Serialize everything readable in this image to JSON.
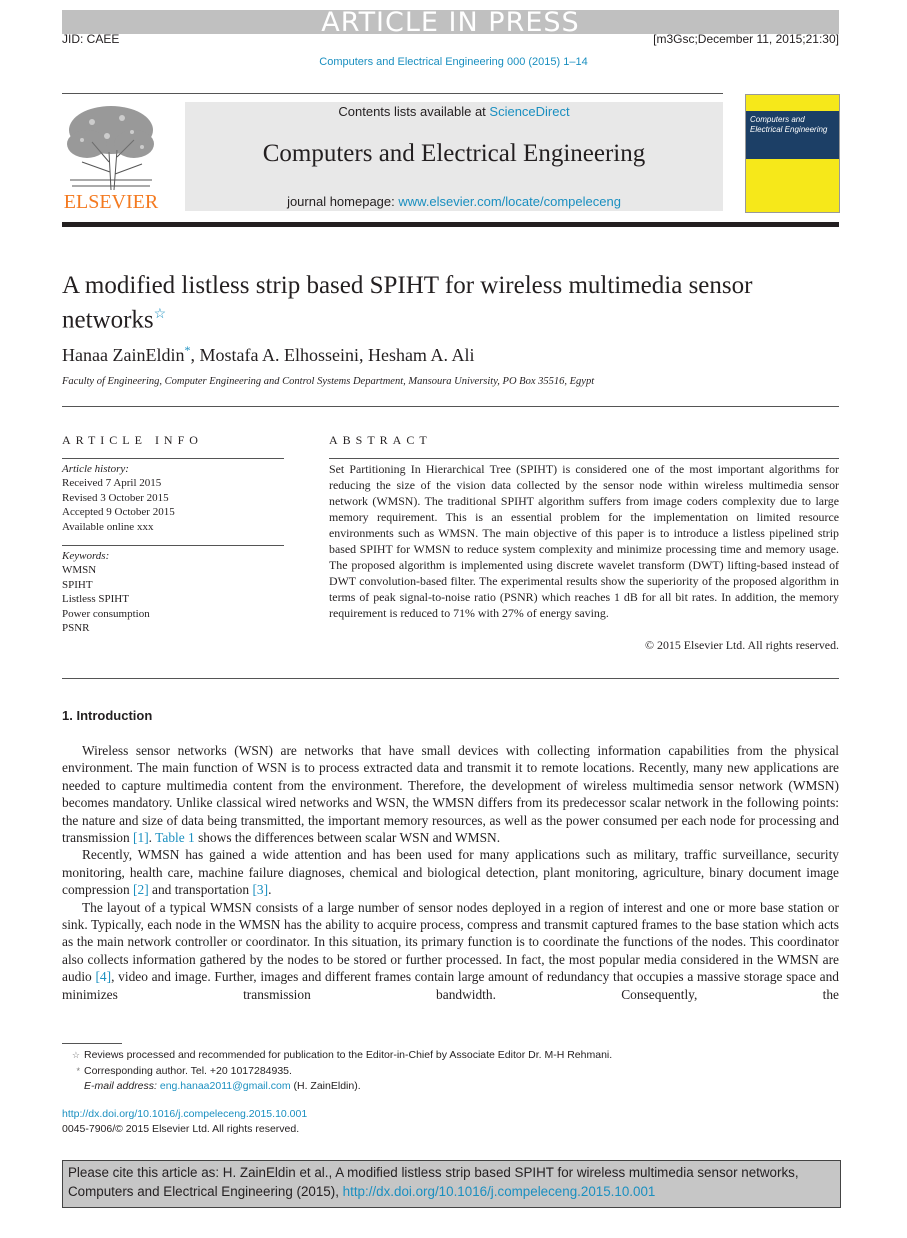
{
  "banner": {
    "status": "ARTICLE IN PRESS",
    "jid": "JID: CAEE",
    "stamp": "[m3Gsc;December 11, 2015;21:30]",
    "journal_ref": "Computers and Electrical Engineering 000 (2015) 1–14"
  },
  "masthead": {
    "publisher": "ELSEVIER",
    "contents_prefix": "Contents lists available at ",
    "contents_link": "ScienceDirect",
    "journal_title": "Computers and Electrical Engineering",
    "homepage_prefix": "journal homepage: ",
    "homepage_link": "www.elsevier.com/locate/compeleceng",
    "cover_title_line1": "Computers and",
    "cover_title_line2": "Electrical Engineering",
    "colors": {
      "publisher_orange": "#f47a20",
      "link_blue": "#1a8fc0",
      "cover_yellow": "#f6e81a",
      "cover_navy": "#1c3f66"
    }
  },
  "article": {
    "title": "A modified listless strip based SPIHT for wireless multimedia sensor networks",
    "title_mark": "☆",
    "authors": [
      {
        "name": "Hanaa ZainEldin",
        "mark": "*",
        "sep": ", "
      },
      {
        "name": "Mostafa A. Elhosseini",
        "mark": "",
        "sep": ", "
      },
      {
        "name": "Hesham A. Ali",
        "mark": "",
        "sep": ""
      }
    ],
    "affiliation": "Faculty of Engineering, Computer Engineering and Control Systems Department, Mansoura University, PO Box 35516, Egypt"
  },
  "article_info": {
    "heading": "ARTICLE INFO",
    "history_label": "Article history:",
    "history": [
      "Received 7 April 2015",
      "Revised 3 October 2015",
      "Accepted 9 October 2015",
      "Available online xxx"
    ],
    "keywords_label": "Keywords:",
    "keywords": [
      "WMSN",
      "SPIHT",
      "Listless SPIHT",
      "Power consumption",
      "PSNR"
    ]
  },
  "abstract": {
    "heading": "ABSTRACT",
    "text": "Set Partitioning In Hierarchical Tree (SPIHT) is considered one of the most important algorithms for reducing the size of the vision data collected by the sensor node within wireless multimedia sensor network (WMSN). The traditional SPIHT algorithm suffers from image coders complexity due to large memory requirement. This is an essential problem for the implementation on limited resource environments such as WMSN. The main objective of this paper is to introduce a listless pipelined strip based SPIHT for WMSN to reduce system complexity and minimize processing time and memory usage. The proposed algorithm is implemented using discrete wavelet transform (DWT) lifting-based instead of DWT convolution-based filter. The experimental results show the superiority of the proposed algorithm in terms of peak signal-to-noise ratio (PSNR) which reaches 1 dB for all bit rates. In addition, the memory requirement is reduced to 71% with 27% of energy saving.",
    "copyright": "© 2015 Elsevier Ltd. All rights reserved."
  },
  "introduction": {
    "heading": "1.  Introduction",
    "p1": {
      "a": "Wireless sensor networks (WSN) are networks that have small devices with collecting information capabilities from the physical environment. The main function of WSN is to process extracted data and transmit it to remote locations. Recently, many new applications are needed to capture multimedia content from the environment. Therefore, the development of wireless multimedia sensor network (WMSN) becomes mandatory. Unlike classical wired networks and WSN, the WMSN differs from its predecessor scalar network in the following points: the nature and size of data being transmitted, the important memory resources, as well as the power consumed per each node for processing and transmission ",
      "ref1": "[1]",
      "b": ". ",
      "table_ref": "Table 1",
      "c": " shows the differences between scalar WSN and WMSN."
    },
    "p2": {
      "a": "Recently, WMSN has gained a wide attention and has been used for many applications such as military, traffic surveillance, security monitoring, health care, machine failure diagnoses, chemical and biological detection, plant monitoring, agriculture, binary document image compression ",
      "ref2": "[2]",
      "b": " and transportation ",
      "ref3": "[3]",
      "c": "."
    },
    "p3": {
      "a": "The layout of a typical WMSN consists of a large number of sensor nodes deployed in a region of interest and one or more base station or sink. Typically, each node in the WMSN has the ability to acquire process, compress and transmit captured frames to the base station which acts as the main network controller or coordinator. In this situation, its primary function is to coordinate the functions of the nodes. This coordinator also collects information gathered by the nodes to be stored or further processed. In fact, the most popular media considered in the WMSN are audio ",
      "ref4": "[4]",
      "b": ", video and image. Further, images and different frames contain large amount of redundancy that occupies a massive storage space and minimizes transmission bandwidth. Consequently, the"
    }
  },
  "footnotes": {
    "star_mark": "☆",
    "star_text": "Reviews processed and recommended for publication to the Editor-in-Chief by Associate Editor Dr. M-H Rehmani.",
    "corr_mark": "*",
    "corr_text": "Corresponding author. Tel. +20 1017284935.",
    "email_label": "E-mail address:",
    "email": "eng.hanaa2011@gmail.com",
    "email_owner": "(H. ZainEldin)."
  },
  "doi": {
    "url": "http://dx.doi.org/10.1016/j.compeleceng.2015.10.001",
    "issn": "0045-7906/© 2015 Elsevier Ltd. All rights reserved."
  },
  "citation": {
    "text": "Please cite this article as: H. ZainEldin et al., A modified listless strip based SPIHT for wireless multimedia sensor networks, Computers and Electrical Engineering (2015), ",
    "url": "http://dx.doi.org/10.1016/j.compeleceng.2015.10.001"
  }
}
